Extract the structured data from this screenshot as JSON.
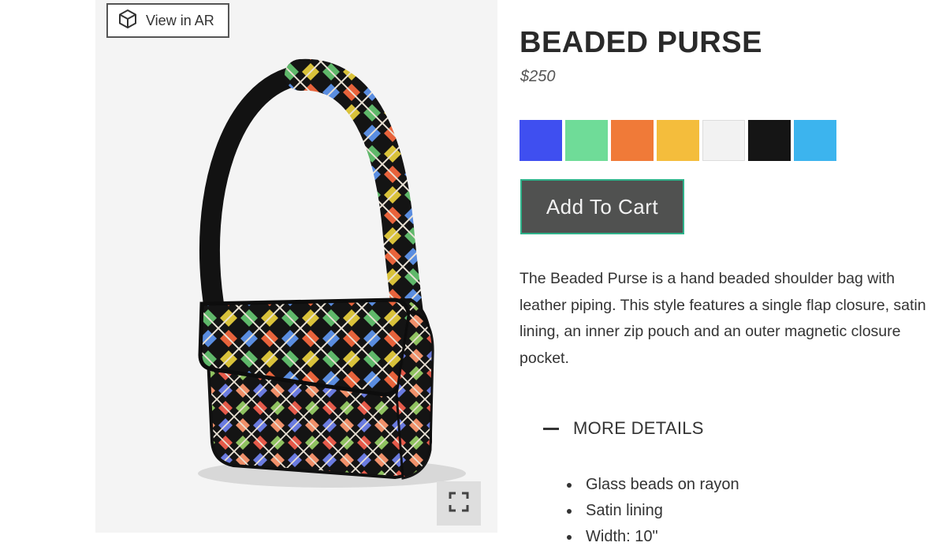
{
  "viewer": {
    "ar_button": {
      "label": "View in AR",
      "icon": "cube-icon"
    },
    "fullscreen_button": {
      "icon": "fullscreen-icon"
    }
  },
  "product": {
    "title": "BEADED PURSE",
    "price": "$250",
    "swatches": [
      {
        "name": "blue",
        "color": "#3f4ff0"
      },
      {
        "name": "mint",
        "color": "#6fdc98"
      },
      {
        "name": "orange",
        "color": "#f07a38"
      },
      {
        "name": "yellow",
        "color": "#f4bd3c"
      },
      {
        "name": "white",
        "color": "#f2f2f2"
      },
      {
        "name": "black",
        "color": "#151515"
      },
      {
        "name": "sky-blue",
        "color": "#3cb4ee"
      }
    ],
    "add_to_cart_label": "Add To Cart",
    "description": "The Beaded Purse is a hand beaded shoulder bag with leather piping. This style features a single flap closure, satin lining, an inner zip pouch and an outer magnetic closure pocket.",
    "more_details_label": "MORE DETAILS",
    "details": [
      "Glass beads on rayon",
      "Satin lining",
      "Width: 10\""
    ]
  },
  "colors": {
    "button_bg": "#505150",
    "button_border": "#2fb28a",
    "viewer_bg": "#f4f4f4"
  }
}
